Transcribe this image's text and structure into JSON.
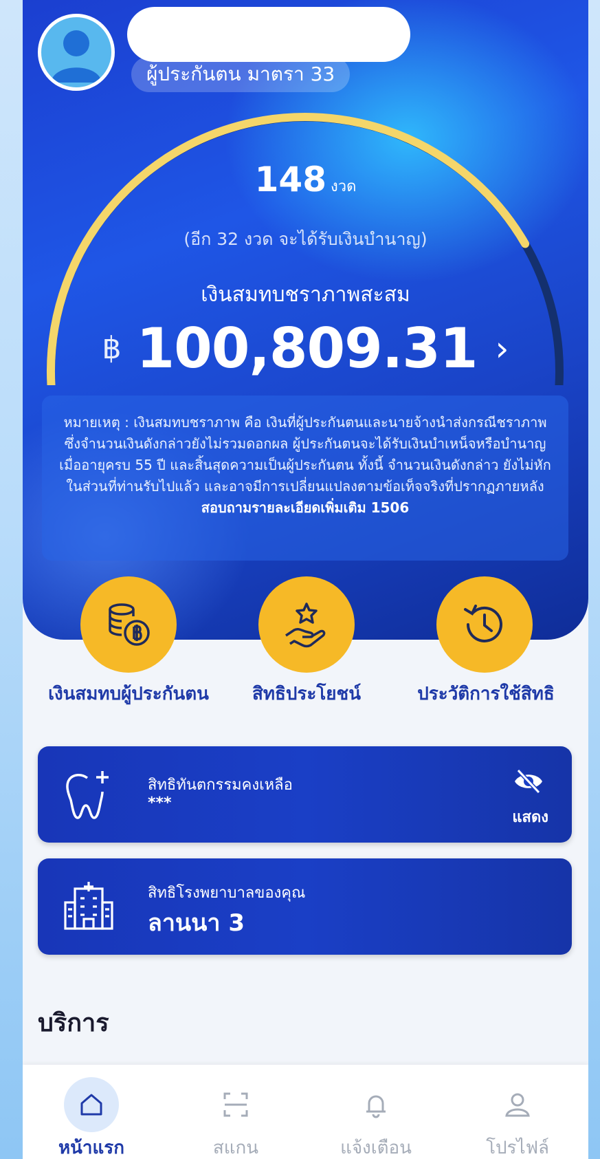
{
  "profile": {
    "insurance_type": "ผู้ประกันตน มาตรา 33"
  },
  "gauge": {
    "progress_fraction": 0.82,
    "installments": "148",
    "installments_unit": "งวด",
    "remaining_text": "(อีก 32 งวด จะได้รับเงินบำนาญ)",
    "savings_label": "เงินสมทบชราภาพสะสม",
    "currency_symbol": "฿",
    "amount": "100,809.31",
    "chevron": "›"
  },
  "note": {
    "text": "หมายเหตุ : เงินสมทบชราภาพ คือ เงินที่ผู้ประกันตนและนายจ้างนำส่งกรณีชราภาพ ซึ่งจำนวนเงินดังกล่าวยังไม่รวมดอกผล ผู้ประกันตนจะได้รับเงินบำเหน็จหรือบำนาญ เมื่ออายุครบ 55 ปี และสิ้นสุดความเป็นผู้ประกันตน ทั้งนี้ จำนวนเงินดังกล่าว ยังไม่หักในส่วนที่ท่านรับไปแล้ว และอาจมีการเปลี่ยนแปลงตามข้อเท็จจริงที่ปรากฏภายหลัง",
    "contact": "สอบถามรายละเอียดเพิ่มเติม 1506"
  },
  "quick_actions": [
    {
      "label": "เงินสมทบผู้ประกันตน",
      "icon": "coins-baht-icon"
    },
    {
      "label": "สิทธิประโยชน์",
      "icon": "hand-star-icon"
    },
    {
      "label": "ประวัติการใช้สิทธิ",
      "icon": "history-clock-icon"
    }
  ],
  "dental_card": {
    "title": "สิทธิทันตกรรมคงเหลือ",
    "value": "***",
    "toggle_label": "แสดง",
    "icon": "tooth-plus-icon"
  },
  "hospital_card": {
    "title": "สิทธิโรงพยาบาลของคุณ",
    "value": "ลานนา 3",
    "icon": "hospital-icon"
  },
  "services": {
    "heading": "บริการ"
  },
  "tabs": [
    {
      "label": "หน้าแรก",
      "icon": "home-icon",
      "active": true
    },
    {
      "label": "สแกน",
      "icon": "scan-icon",
      "active": false
    },
    {
      "label": "แจ้งเตือน",
      "icon": "bell-icon",
      "active": false
    },
    {
      "label": "โปรไฟล์",
      "icon": "user-icon",
      "active": false
    }
  ],
  "colors": {
    "hero_blue": "#1f56e6",
    "gauge_yellow": "#f4d66a",
    "gauge_track": "#14306e",
    "accent_orange": "#f6b927",
    "card_navy": "#1a3fc6",
    "active_tab": "#1f3aa8"
  }
}
